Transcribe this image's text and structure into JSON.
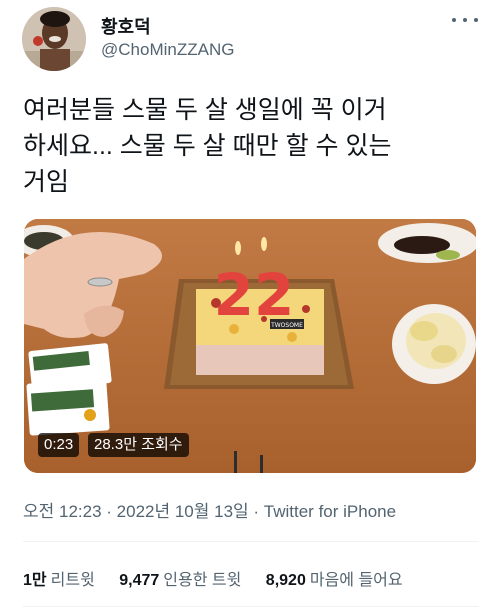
{
  "user": {
    "name": "황호덕",
    "handle": "@ChoMinZZANG"
  },
  "tweet": {
    "text": "여러분들 스물 두 살 생일에 꼭 이거\n하세요... 스물 두 살 때만 할 수 있는\n거임"
  },
  "media": {
    "duration": "0:23",
    "views": "28.3만 조회수",
    "cake_plate_text": "TWOSOME",
    "candle_number": "22"
  },
  "meta": {
    "time": "오전 12:23",
    "separator1": " · ",
    "date": "2022년 10월 13일",
    "separator2": " · ",
    "source": "Twitter for iPhone"
  },
  "stats": {
    "retweets_count": "1만",
    "retweets_label": "리트윗",
    "quotes_count": "9,477",
    "quotes_label": "인용한 트윗",
    "likes_count": "8,920",
    "likes_label": "마음에 들어요"
  },
  "colors": {
    "secondary_text": "#536471",
    "primary_text": "#0f1419",
    "divider": "#eff3f4"
  }
}
